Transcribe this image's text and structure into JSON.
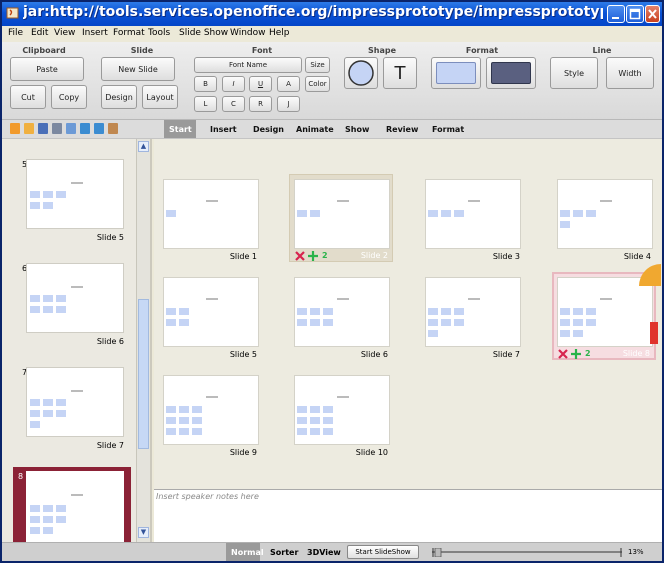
{
  "window": {
    "title": "jar:http://tools.services.openoffice.org/impressprototype/impressprototype.jar!/org/openoffi..."
  },
  "menu": [
    "File",
    "Edit",
    "View",
    "Insert",
    "Format",
    "Tools",
    "Slide Show",
    "Window",
    "Help"
  ],
  "ribbon": {
    "groups": {
      "clipboard": "Clipboard",
      "slide": "Slide",
      "font": "Font",
      "shape": "Shape",
      "format": "Format",
      "line": "Line"
    },
    "buttons": {
      "paste": "Paste",
      "cut": "Cut",
      "copy": "Copy",
      "new_slide": "New Slide",
      "design": "Design",
      "layout": "Layout",
      "font_name": "Font Name",
      "size": "Size",
      "color": "Color",
      "bold": "B",
      "italic": "I",
      "underline": "U",
      "shadow": "A",
      "align_left": "L",
      "align_center": "C",
      "align_right": "R",
      "justify": "J",
      "text_shape": "T",
      "style": "Style",
      "width": "Width"
    }
  },
  "tabs": [
    "Start",
    "Insert",
    "Design",
    "Animate",
    "Show",
    "Review",
    "Format"
  ],
  "active_tab": "Start",
  "colors": {
    "selection": "#8b2236",
    "hover_border": "#e8b8bf",
    "fill_sample": "#c5d4f5",
    "dark_sample": "#5a6080"
  },
  "left_panel": {
    "slides": [
      {
        "number": "5",
        "label": "Slide 5"
      },
      {
        "number": "6",
        "label": "Slide 6"
      },
      {
        "number": "7",
        "label": "Slide 7"
      },
      {
        "number": "8",
        "label": ""
      }
    ]
  },
  "sorter": {
    "slides": [
      {
        "label": "Slide 1"
      },
      {
        "label": "Slide 2"
      },
      {
        "label": "Slide 3"
      },
      {
        "label": "Slide 4"
      },
      {
        "label": "Slide 5"
      },
      {
        "label": "Slide 6"
      },
      {
        "label": "Slide 7"
      },
      {
        "label": "Slide 8"
      },
      {
        "label": "Slide 9"
      },
      {
        "label": "Slide 10"
      }
    ],
    "overlay_count": "2"
  },
  "notes": {
    "placeholder": "Insert speaker notes here"
  },
  "status": {
    "views": [
      "Normal",
      "Sorter",
      "3DView"
    ],
    "active_view": "Normal",
    "start_slideshow": "Start SlideShow",
    "zoom": "13%"
  }
}
